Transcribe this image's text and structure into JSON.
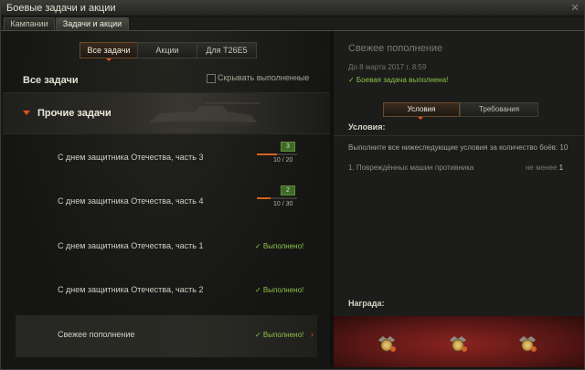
{
  "window": {
    "title": "Боевые задачи и акции",
    "close_icon": "close-icon"
  },
  "main_tabs": [
    {
      "label": "Кампании",
      "active": false
    },
    {
      "label": "Задачи и акции",
      "active": true
    }
  ],
  "filters": [
    {
      "label": "Все задачи",
      "active": true
    },
    {
      "label": "Акции",
      "active": false
    },
    {
      "label": "Для T26E5",
      "active": false
    }
  ],
  "list": {
    "heading": "Все задачи",
    "hide_completed_label": "Скрывать выполненные",
    "hide_completed_checked": false,
    "category": "Прочие задачи"
  },
  "tasks": [
    {
      "label": "С днем защитника Отечества, часть 3",
      "level": "3",
      "progress_text": "10 / 20",
      "progress": 0.5
    },
    {
      "label": "С днем защитника Отечества, часть 4",
      "level": "2",
      "progress_text": "10 / 30",
      "progress": 0.333
    },
    {
      "label": "С днем защитника Отечества, часть 1",
      "status": "✓ Выполнено!"
    },
    {
      "label": "С днем защитника Отечества, часть 2",
      "status": "✓ Выполнено!"
    },
    {
      "label": "Свежее пополнение",
      "status": "✓ Выполнено!",
      "selected": true
    }
  ],
  "detail": {
    "title": "Свежее пополнение",
    "date": "До 8 марта 2017 г. 8:59",
    "status": "✓ Боевая задача выполнена!",
    "subtabs": [
      {
        "label": "Условия",
        "active": true
      },
      {
        "label": "Требования",
        "active": false
      }
    ],
    "conditions_heading": "Условия:",
    "conditions_intro": "Выполните все нижеследующие условия за количество боёв: 10",
    "condition": {
      "text": "1. Повреждённых машин противника",
      "requirement_prefix": "не менее",
      "requirement_value": "1"
    },
    "reward_heading": "Награда:",
    "reward_icons": [
      "credits-reserve-icon",
      "credits-reserve-icon",
      "credits-reserve-icon"
    ]
  },
  "colors": {
    "accent_orange": "#e0531a",
    "done_green": "#8bc34a",
    "reward_red": "#8a2420"
  }
}
